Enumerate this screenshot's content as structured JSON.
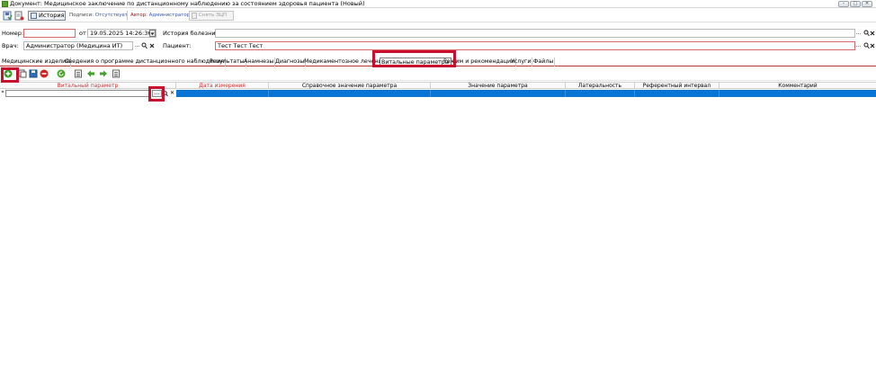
{
  "window": {
    "title": "Документ: Медицинское заключение по дистанционному наблюдению за состоянием здоровья пациента (Новый)"
  },
  "toolbar": {
    "history_label": "История",
    "signatures_label": "Подписи:",
    "signatures_value": "Отсутствует",
    "author_label": "Автор:",
    "author_value": "Администратор",
    "remove_signature_label": "Снять ЭЦП"
  },
  "form": {
    "number_label": "Номер:",
    "number_value": "",
    "date_prefix": "от",
    "date_value": "19.05.2025 14:26:36",
    "history_label": "История болезни:",
    "history_value": "",
    "doctor_label": "Врач:",
    "doctor_value": "Администратор (Медицина ИТ)",
    "patient_label": "Пациент:",
    "patient_value": "Тест Тест Тест"
  },
  "tabs": [
    {
      "label": "Медицинские изделия"
    },
    {
      "label": "Сведения о программе дистанционного наблюдения"
    },
    {
      "label": "Результаты"
    },
    {
      "label": "Анамнезы"
    },
    {
      "label": "Диагнозы"
    },
    {
      "label": "Медикаментозное лечение"
    },
    {
      "label": "Витальные параметры",
      "active": true
    },
    {
      "label": "Режим и рекомендации"
    },
    {
      "label": "Услуги"
    },
    {
      "label": "Файлы"
    }
  ],
  "grid": {
    "columns": [
      {
        "label": "Витальный параметр",
        "required": true
      },
      {
        "label": "Дата измерения",
        "required": true
      },
      {
        "label": "Справочное значение параметра"
      },
      {
        "label": "Значение параметра"
      },
      {
        "label": "Латеральность"
      },
      {
        "label": "Референтный интервал"
      },
      {
        "label": "Комментарий"
      }
    ],
    "new_row_marker": "*",
    "ellipsis": "...",
    "clear_glyph": "✕"
  },
  "icons": {
    "add": "plus-circle-icon",
    "delete": "minus-circle-icon",
    "refresh": "refresh-icon",
    "move_left": "arrow-left-icon",
    "move_right": "arrow-right-icon"
  },
  "colors": {
    "highlight": "#c8102e",
    "selected_row": "#0a74d4",
    "required_text": "#d03030",
    "add_green": "#3a9a2a"
  }
}
